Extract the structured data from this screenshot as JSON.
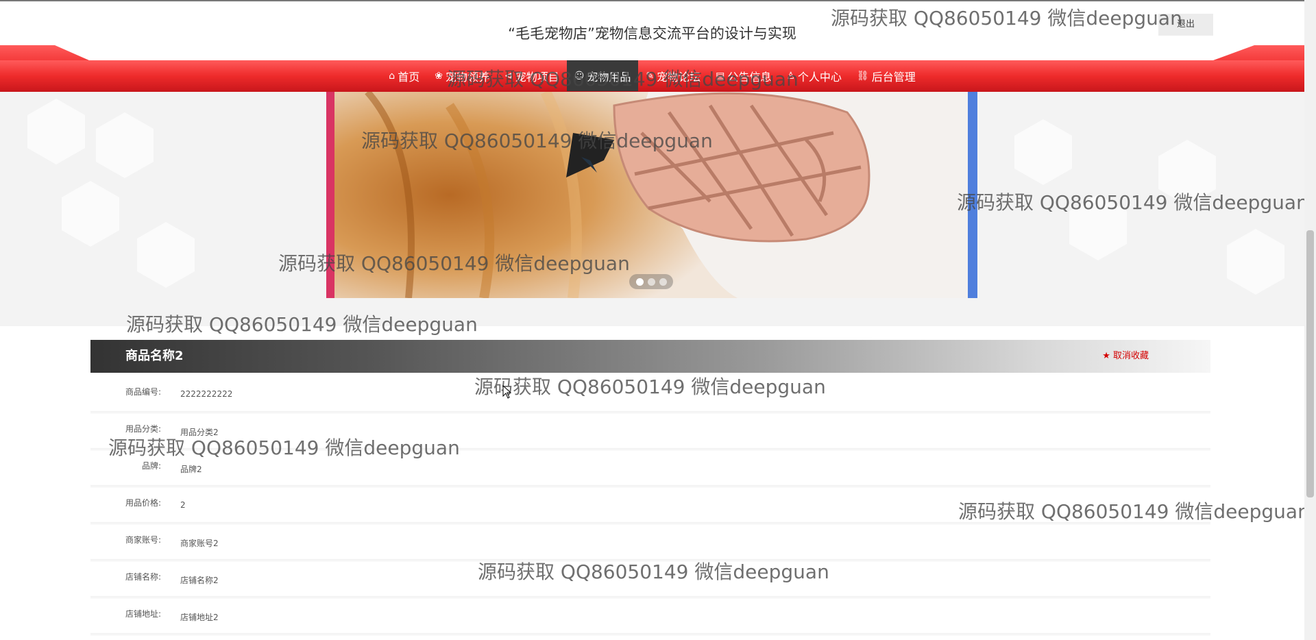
{
  "header": {
    "site_title": "“毛毛宠物店”宠物信息交流平台的设计与实现",
    "logout_label": "退出"
  },
  "nav": {
    "items": [
      {
        "label": "首页",
        "icon": "home-icon"
      },
      {
        "label": "宠物领养",
        "icon": "paw-icon"
      },
      {
        "label": "宠物项目",
        "icon": "tag-icon"
      },
      {
        "label": "宠物用品",
        "icon": "chat-icon"
      },
      {
        "label": "宠物论坛",
        "icon": "forum-icon"
      },
      {
        "label": "公告信息",
        "icon": "notice-icon"
      },
      {
        "label": "个人中心",
        "icon": "user-icon"
      },
      {
        "label": "后台管理",
        "icon": "link-icon"
      }
    ],
    "active_index": 3,
    "colors": {
      "bar": "#e8232a",
      "active": "#3a3a3a"
    }
  },
  "banner": {
    "slide_count": 3,
    "current": 1,
    "image_subject": "dog-muzzle-photo"
  },
  "detail": {
    "title": "商品名称2",
    "favorite_label": "取消收藏",
    "favorite_icon": "star-icon",
    "fields": [
      {
        "label": "商品编号:",
        "value": "2222222222"
      },
      {
        "label": "用品分类:",
        "value": "用品分类2"
      },
      {
        "label": "品牌:",
        "value": "品牌2"
      },
      {
        "label": "用品价格:",
        "value": "2"
      },
      {
        "label": "商家账号:",
        "value": "商家账号2"
      },
      {
        "label": "店铺名称:",
        "value": "店铺名称2"
      },
      {
        "label": "店铺地址:",
        "value": "店铺地址2"
      }
    ]
  },
  "watermark": {
    "text": "源码获取 QQ86050149 微信deepguan"
  }
}
